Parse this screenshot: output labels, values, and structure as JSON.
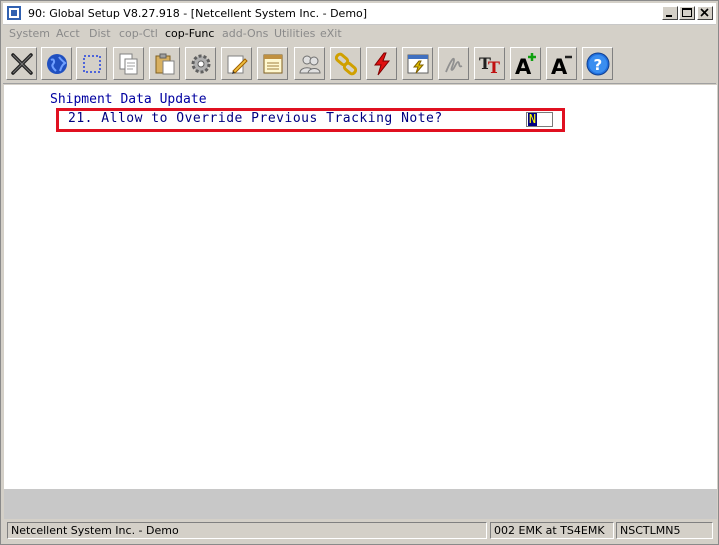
{
  "window": {
    "title": "90: Global Setup V8.27.918 - [Netcellent System Inc. - Demo]"
  },
  "menu": [
    {
      "label": "System",
      "enabled": false
    },
    {
      "label": "Acct",
      "enabled": false
    },
    {
      "label": "Dist",
      "enabled": false
    },
    {
      "label": "cop-Ctl",
      "enabled": false
    },
    {
      "label": "cop-Func",
      "enabled": true
    },
    {
      "label": "add-Ons",
      "enabled": false
    },
    {
      "label": "Utilities",
      "enabled": false
    },
    {
      "label": "eXit",
      "enabled": false
    }
  ],
  "toolbar": {
    "icons": [
      "close-x-icon",
      "globe-icon",
      "select-rect-icon",
      "copy-icon",
      "paste-icon",
      "settings-gear-icon",
      "edit-pencil-icon",
      "notes-icon",
      "users-icon",
      "link-chain-icon",
      "lightning-icon",
      "calendar-flash-icon",
      "signature-icon",
      "font-tt-icon",
      "font-increase-icon",
      "font-decrease-icon",
      "help-icon"
    ]
  },
  "screen": {
    "section_title": "Shipment Data Update",
    "field_label": "21. Allow to Override Previous Tracking Note?",
    "field_value": "N"
  },
  "status": {
    "company": "Netcellent System Inc. - Demo",
    "session": "002 EMK at TS4EMK",
    "program": "NSCTLMN5"
  }
}
